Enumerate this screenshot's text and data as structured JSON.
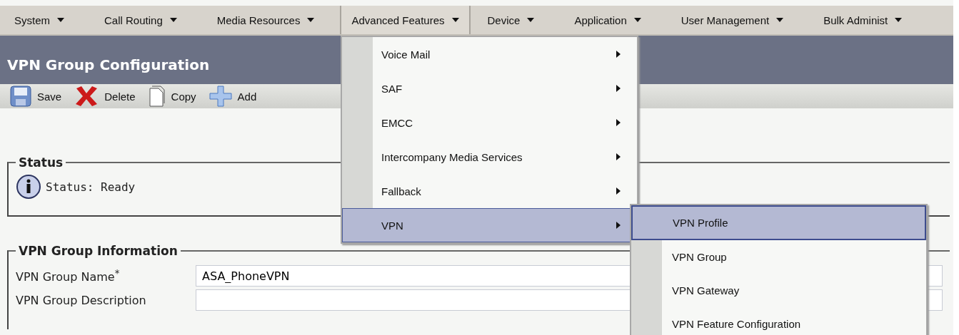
{
  "menu_bar": [
    {
      "label": "System",
      "selected": false
    },
    {
      "label": "Call Routing",
      "selected": false
    },
    {
      "label": "Media Resources",
      "selected": false
    },
    {
      "label": "Advanced Features",
      "selected": true
    },
    {
      "label": "Device",
      "selected": false
    },
    {
      "label": "Application",
      "selected": false
    },
    {
      "label": "User Management",
      "selected": false
    },
    {
      "label": "Bulk Administ",
      "selected": false
    }
  ],
  "page_title": "VPN Group Configuration",
  "toolbar": [
    {
      "label": "Save",
      "kind": "save"
    },
    {
      "label": "Delete",
      "kind": "delete"
    },
    {
      "label": "Copy",
      "kind": "copy"
    },
    {
      "label": "Add",
      "kind": "add"
    }
  ],
  "status": {
    "legend": "Status",
    "text": "Status: Ready"
  },
  "info": {
    "legend": "VPN Group Information",
    "fields": [
      {
        "label": "VPN Group Name$^{*}$",
        "value": "ASA_PhoneVPN"
      },
      {
        "label": "VPN Group Description"
      }
    ]
  },
  "dropdown": [
    {
      "label": "Voice Mail",
      "selected": false
    },
    {
      "label": "SAF",
      "selected": false
    },
    {
      "label": "EMCC",
      "selected": false
    },
    {
      "label": "Intercompany Media Services",
      "selected": false
    },
    {
      "label": "Fallback",
      "selected": false
    },
    {
      "label": "VPN",
      "selected": true
    }
  ],
  "submenu": [
    {
      "label": "VPN Profile",
      "selected": true
    },
    {
      "label": "VPN Group",
      "selected": false
    },
    {
      "label": "VPN Gateway",
      "selected": false
    },
    {
      "label": "VPN Feature Configuration",
      "selected": false
    }
  ]
}
